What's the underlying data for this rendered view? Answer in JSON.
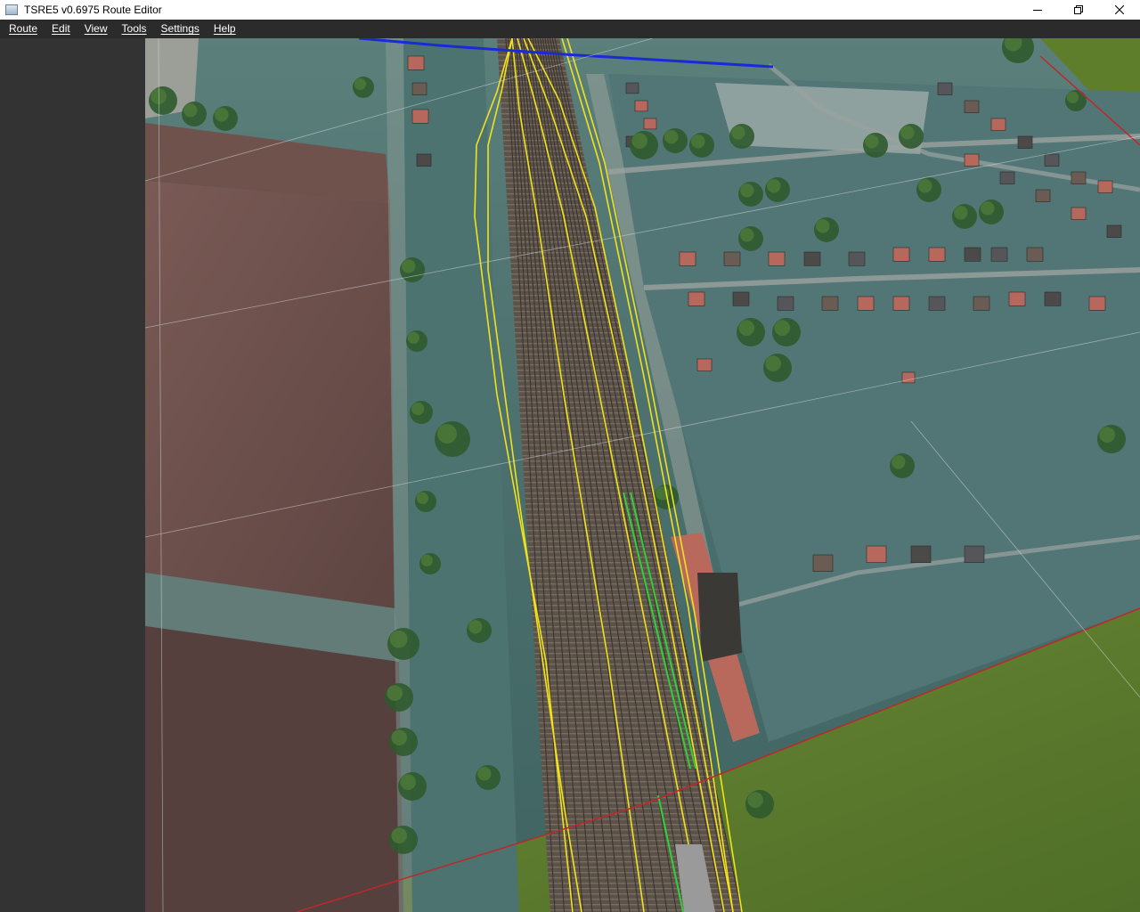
{
  "window": {
    "title": "TSRE5 v0.6975 Route Editor",
    "controls": [
      "minimize-icon",
      "restore-icon",
      "close-icon"
    ]
  },
  "menu": {
    "items": [
      {
        "label": "Route"
      },
      {
        "label": "Edit"
      },
      {
        "label": "View"
      },
      {
        "label": "Tools"
      },
      {
        "label": "Settings"
      },
      {
        "label": "Help"
      }
    ]
  },
  "viewport": {
    "description_colors": {
      "grass": "#5d7a2f",
      "terrain": "#4d706d",
      "field": "#6d4f4a",
      "track_highlight": "#f2e21c",
      "platform_highlight": "#2fd13a",
      "tile_border": "#c0272a",
      "selection_line": "#1a2ad8"
    }
  },
  "colors": {
    "titlebar": "#ffffff",
    "menubar": "#2b2b2b",
    "left_panel": "#333333"
  }
}
